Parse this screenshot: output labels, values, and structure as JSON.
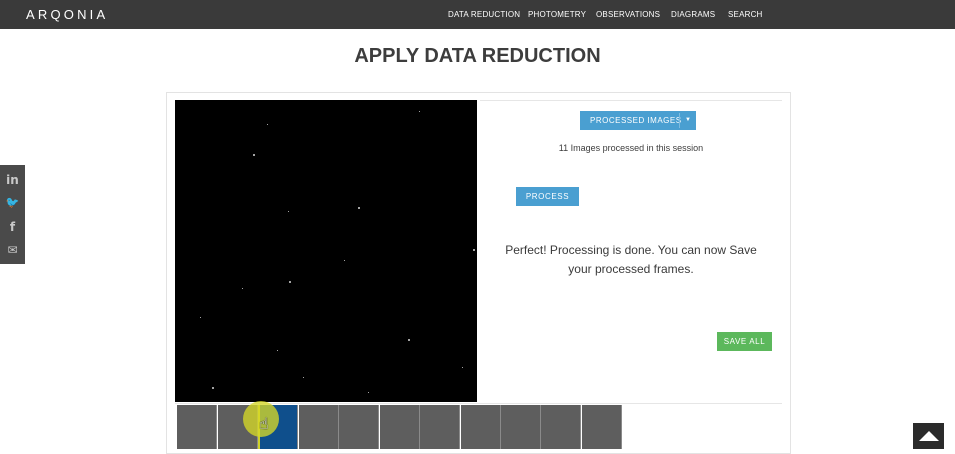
{
  "header": {
    "brand": "ARQONIA",
    "nav": [
      "DATA REDUCTION",
      "PHOTOMETRY",
      "OBSERVATIONS",
      "DIAGRAMS",
      "SEARCH"
    ]
  },
  "page": {
    "title": "APPLY DATA REDUCTION"
  },
  "controls": {
    "processed_dropdown": "PROCESSED IMAGES",
    "images_count_text": "11 Images processed in this session",
    "process_button": "PROCESS",
    "message": "Perfect! Processing is done. You can now Save your processed frames.",
    "save_all_button": "SAVE ALL"
  },
  "thumbnails": {
    "count": 11,
    "active_index": 2
  },
  "social": {
    "icons": [
      "linkedin-icon",
      "twitter-icon",
      "facebook-icon",
      "email-icon"
    ],
    "glyphs": [
      "in",
      "🐦",
      "f",
      "✉"
    ]
  },
  "colors": {
    "header_bg": "#3a3a3a",
    "accent_blue": "#4a9fd1",
    "save_green": "#5cb85c",
    "thumb_gray": "#5e5e5e",
    "thumb_active": "#0f4f8c"
  }
}
